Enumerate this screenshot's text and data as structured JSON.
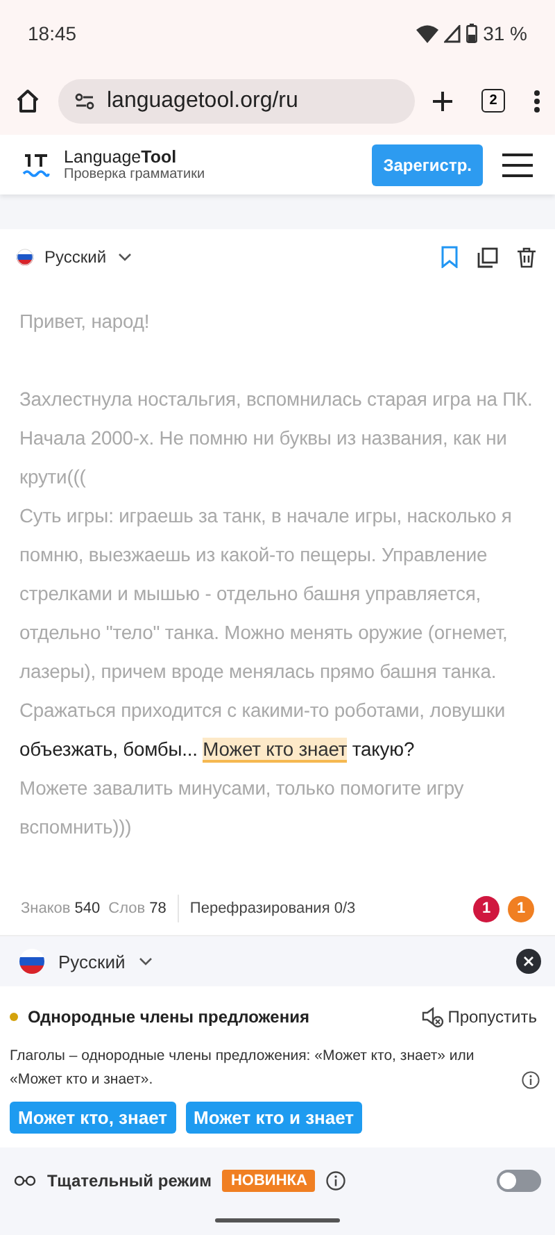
{
  "status_bar": {
    "time": "18:45",
    "battery": "31 %"
  },
  "browser": {
    "url": "languagetool.org/ru",
    "tab_count": "2"
  },
  "header": {
    "brand_regular": "Language",
    "brand_bold": "Tool",
    "subtitle": "Проверка грамматики",
    "signup": "Зарегистр."
  },
  "editor": {
    "language": "Русский",
    "paragraphs": [
      [
        {
          "kind": "dim",
          "text": "Привет, народ!"
        }
      ],
      [
        {
          "kind": "dim",
          "text": "Захлестнула ностальгия, вспомнилась старая игра на ПК. Начала 2000-х. Не помню ни буквы из названия, как ни крути((("
        }
      ],
      [
        {
          "kind": "dim",
          "text": "Суть игры: играешь за танк, в начале игры, насколько я помню, выезжаешь из какой-то пещеры. Управление стрелками и мышью - отдельно башня управляется, отдельно \"тело\" танка. Можно менять оружие (огнемет, лазеры), причем вроде менялась прямо башня танка. Сражаться приходится с какими-то роботами, ловушки "
        },
        {
          "kind": "active",
          "text": "объезжать, бомбы... "
        },
        {
          "kind": "error",
          "text": "Может кто знает"
        },
        {
          "kind": "active",
          "text": " такую?"
        }
      ],
      [
        {
          "kind": "dim",
          "text": "Можете завалить минусами, только помогите игру вспомнить)))"
        }
      ]
    ]
  },
  "stats": {
    "chars_label": "Знаков",
    "chars": "540",
    "words_label": "Слов",
    "words": "78",
    "rephrase": "Перефразирования 0/3",
    "badges": [
      {
        "text": "1",
        "color": "#d0173f"
      },
      {
        "text": "1",
        "color": "#f07f22"
      }
    ]
  },
  "panel": {
    "language": "Русский",
    "issue": {
      "title": "Однородные члены предложения",
      "color": "#d4a20c",
      "skip": "Пропустить",
      "description": "Глаголы – однородные члены предложения: «Может кто, знает» или «Может кто и знает».",
      "suggestions": [
        "Может кто, знает",
        "Может кто и знает"
      ]
    },
    "mode": {
      "label": "Тщательный режим",
      "badge": "НОВИНКА",
      "on": false
    }
  }
}
